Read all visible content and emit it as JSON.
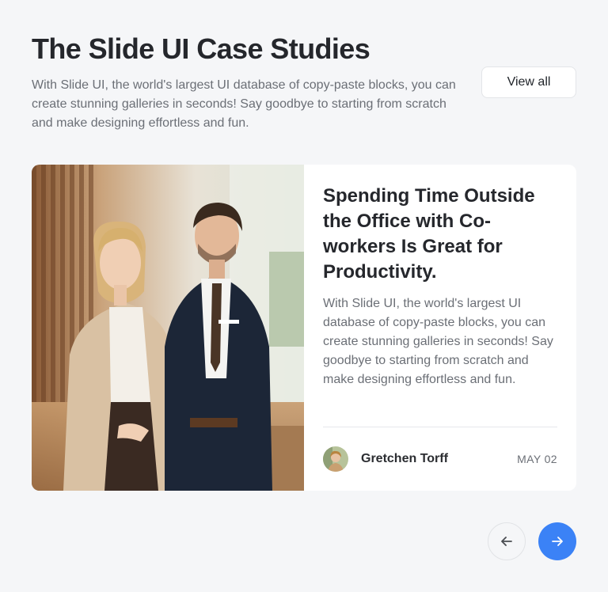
{
  "header": {
    "title": "The Slide UI Case Studies",
    "description": "With Slide UI, the world's largest UI database of copy-paste blocks, you can create stunning galleries in seconds! Say goodbye to starting from scratch and make designing effortless and fun.",
    "view_all_label": "View all"
  },
  "card": {
    "title": "Spending Time Outside the Office with Co-workers Is Great for Productivity.",
    "text": "With Slide UI, the world's largest UI database of copy-paste blocks, you can create stunning galleries in seconds! Say goodbye to starting from scratch and make designing effortless and fun.",
    "author": "Gretchen Torff",
    "date": "MAY 02"
  },
  "icons": {
    "prev": "arrow-left-icon",
    "next": "arrow-right-icon"
  },
  "colors": {
    "accent": "#3b82f6",
    "background": "#f5f6f8",
    "card": "#ffffff"
  }
}
